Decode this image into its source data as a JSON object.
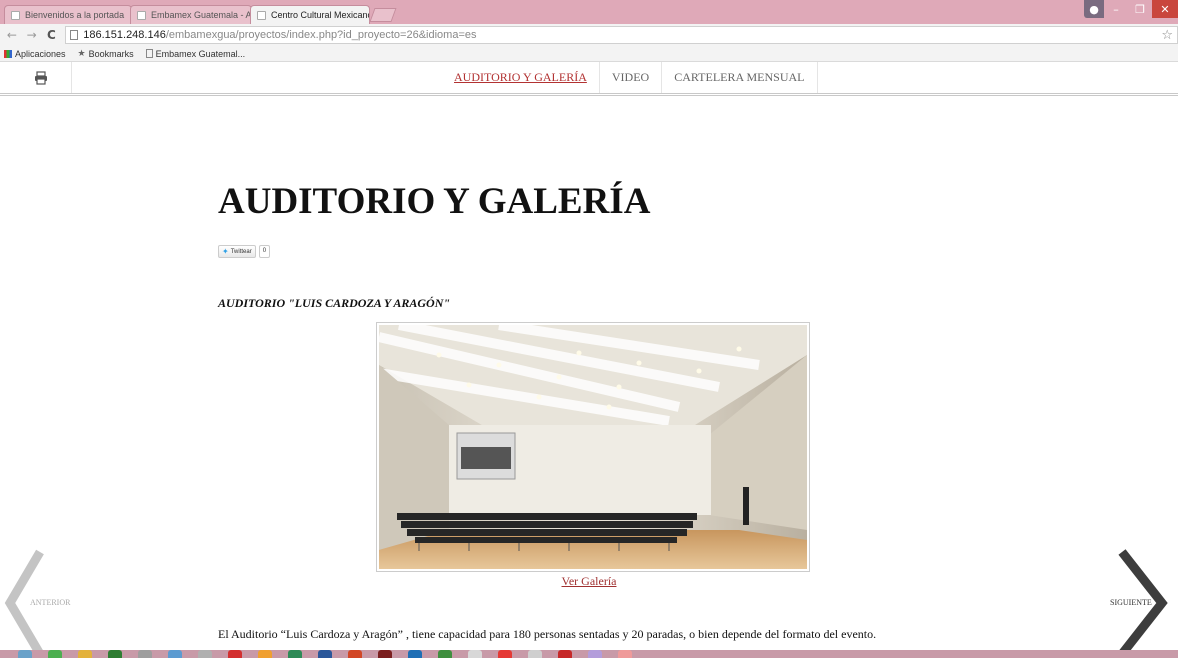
{
  "browser": {
    "tabs": [
      {
        "label": "Bienvenidos a la portada",
        "active": false
      },
      {
        "label": "Embamex Guatemala - Ac",
        "active": false
      },
      {
        "label": "Centro Cultural Mexicano",
        "active": true
      }
    ],
    "url_host": "186.151.248.146",
    "url_rest": "/embamexgua/proyectos/index.php?id_proyecto=26&idioma=es",
    "bookmarks": {
      "apps": "Aplicaciones",
      "bookmarks": "Bookmarks",
      "embamex": "Embamex Guatemal..."
    }
  },
  "site": {
    "menu": [
      "AUDITORIO Y GALERÍA",
      "VIDEO",
      "CARTELERA MENSUAL"
    ],
    "title": "AUDITORIO Y GALERÍA",
    "tweet_label": "Twittear",
    "tweet_count": "0",
    "subheading": "AUDITORIO \"LUIS CARDOZA Y ARAGÓN\"",
    "gallery_link": "Ver Galería",
    "body": "El Auditorio “Luis Cardoza y Aragón” , tiene capacidad para 180 personas sentadas y 20 paradas, o bien depende del formato del evento.",
    "prev_label": "ANTERIOR",
    "next_label": "SIGUIENTE"
  },
  "colors": {
    "tabbar": "#dfa9b8",
    "active_menu": "#b23232",
    "link": "#a03030"
  }
}
